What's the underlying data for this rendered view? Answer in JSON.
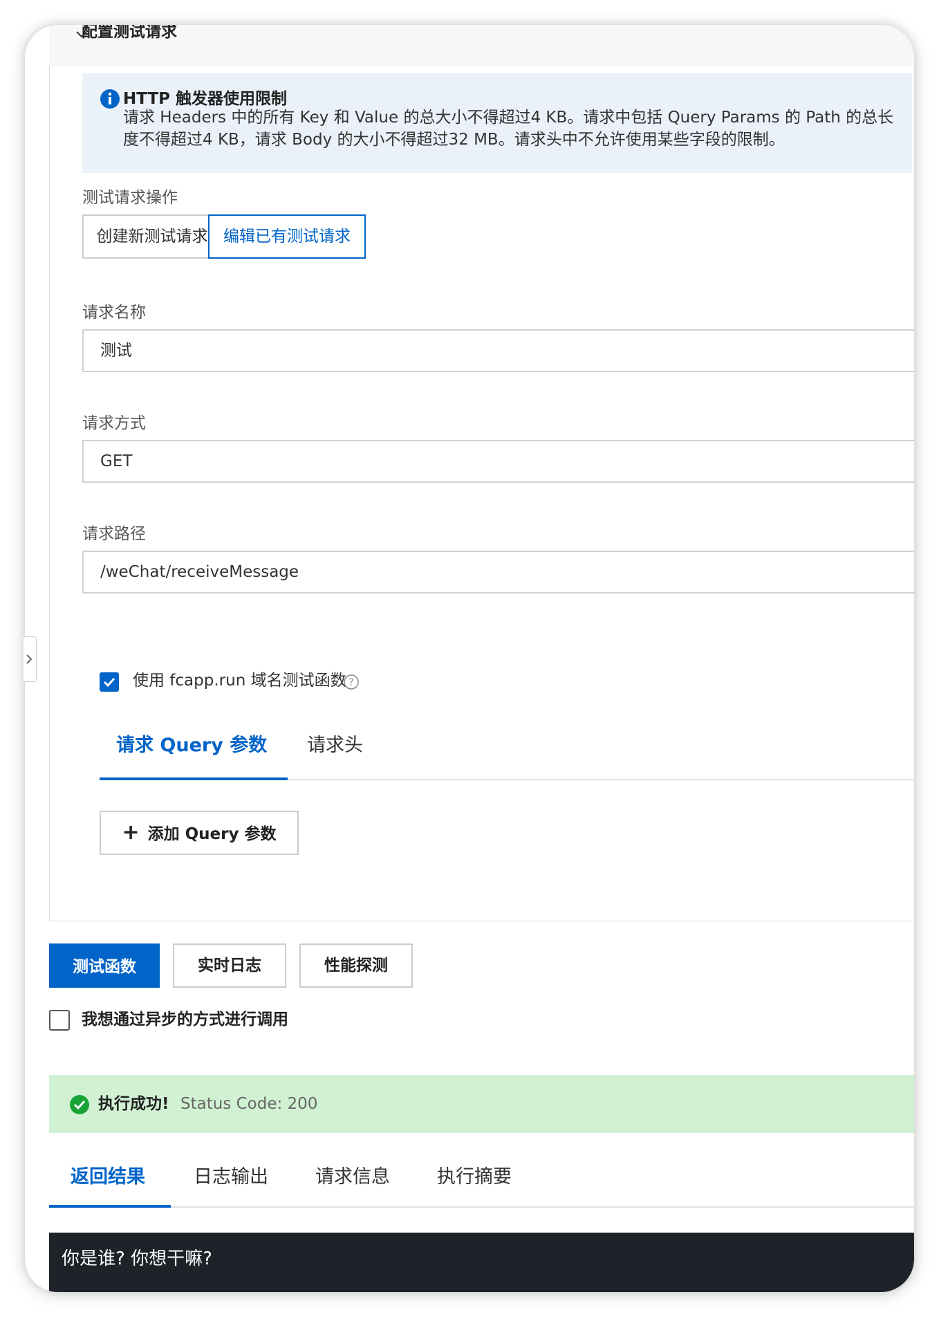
{
  "section": {
    "title": "配置测试请求"
  },
  "notice": {
    "title": "HTTP 触发器使用限制",
    "text": "请求 Headers 中的所有 Key 和 Value 的总大小不得超过4 KB。请求中包括 Query Params 的 Path 的总长度不得超过4 KB，请求 Body 的大小不得超过32 MB。请求头中不允许使用某些字段的限制。",
    "icon": "info-icon"
  },
  "operation": {
    "label": "测试请求操作",
    "create_label": "创建新测试请求",
    "edit_label": "编辑已有测试请求"
  },
  "request_name": {
    "label": "请求名称",
    "value": "测试"
  },
  "request_method": {
    "label": "请求方式",
    "value": "GET"
  },
  "request_path": {
    "label": "请求路径",
    "value": "/weChat/receiveMessage"
  },
  "domain_option": {
    "label": "使用 fcapp.run 域名测试函数",
    "checked": true
  },
  "param_tabs": {
    "query": "请求 Query 参数",
    "headers": "请求头"
  },
  "add_query": {
    "label": "添加 Query 参数"
  },
  "actions": {
    "test": "测试函数",
    "logs": "实时日志",
    "probe": "性能探测"
  },
  "async_option": {
    "label": "我想通过异步的方式进行调用",
    "checked": false
  },
  "status": {
    "message": "执行成功!",
    "code_text": "Status Code: 200"
  },
  "result_tabs": {
    "return": "返回结果",
    "log": "日志输出",
    "request": "请求信息",
    "summary": "执行摘要"
  },
  "result": {
    "text": "你是谁? 你想干嘛?"
  },
  "colors": {
    "primary": "#0064c8",
    "success_bg": "#d1f1d3",
    "notice_bg": "#eaf1f9",
    "result_bg": "#1e2329"
  }
}
